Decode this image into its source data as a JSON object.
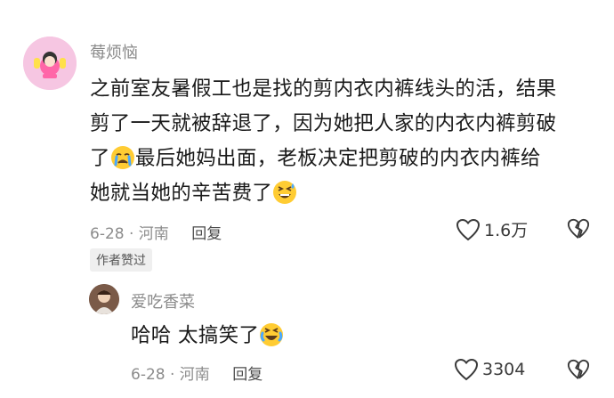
{
  "comments": [
    {
      "username": "莓烦恼",
      "lines": [
        "之前室友暑假工也是找的剪内衣内裤线头的活，结果",
        "剪了一天就被辞退了，因为她把人家的内衣内裤剪破",
        "了",
        "最后她妈出面，老板决定把剪破的内衣内裤给",
        "她就当她的辛苦费了"
      ],
      "meta": "6-28 · 河南",
      "reply_label": "回复",
      "like_count": "1.6万",
      "badge": "作者赞过",
      "emojis": [
        "crying-emoji",
        "grin-sweat-emoji"
      ]
    },
    {
      "username": "爱吃香菜",
      "text": "哈哈 太搞笑了",
      "meta": "6-28 · 河南",
      "reply_label": "回复",
      "like_count": "3304",
      "emojis": [
        "crying-laugh-emoji"
      ]
    }
  ],
  "colors": {
    "text": "#1a1a1a",
    "muted": "#8c8c8c",
    "badge_bg": "#efefef",
    "avatar1_bg": "#f7c9e3"
  }
}
